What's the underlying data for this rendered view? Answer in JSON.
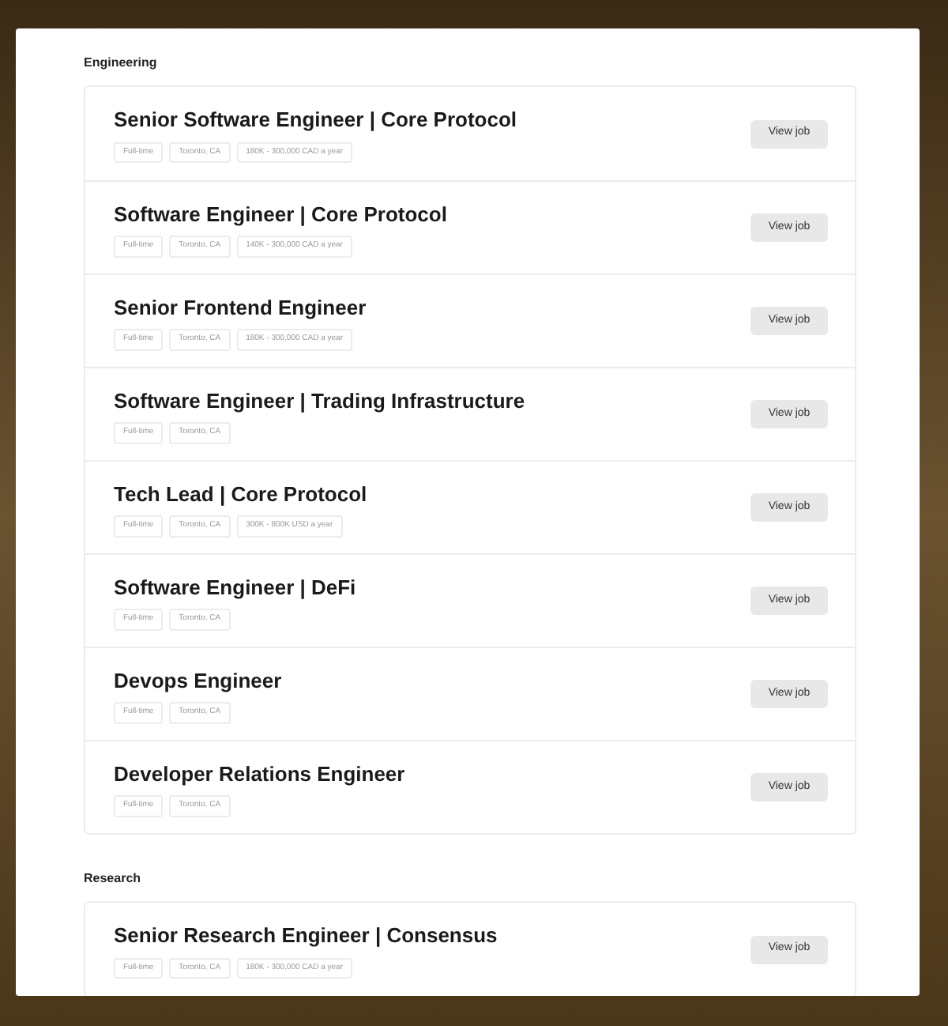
{
  "sections": [
    {
      "heading": "Engineering",
      "jobs": [
        {
          "title": "Senior Software Engineer | Core Protocol",
          "tags": [
            "Full-time",
            "Toronto, CA",
            "180K - 300,000 CAD a year"
          ],
          "button": "View job"
        },
        {
          "title": "Software Engineer | Core Protocol",
          "tags": [
            "Full-time",
            "Toronto, CA",
            "140K - 300,000 CAD a year"
          ],
          "button": "View job"
        },
        {
          "title": "Senior Frontend Engineer",
          "tags": [
            "Full-time",
            "Toronto, CA",
            "180K - 300,000 CAD a year"
          ],
          "button": "View job"
        },
        {
          "title": "Software Engineer | Trading Infrastructure",
          "tags": [
            "Full-time",
            "Toronto, CA"
          ],
          "button": "View job"
        },
        {
          "title": "Tech Lead | Core Protocol",
          "tags": [
            "Full-time",
            "Toronto, CA",
            "300K - 800K USD a year"
          ],
          "button": "View job"
        },
        {
          "title": "Software Engineer | DeFi",
          "tags": [
            "Full-time",
            "Toronto, CA"
          ],
          "button": "View job"
        },
        {
          "title": "Devops Engineer",
          "tags": [
            "Full-time",
            "Toronto, CA"
          ],
          "button": "View job"
        },
        {
          "title": "Developer Relations Engineer",
          "tags": [
            "Full-time",
            "Toronto, CA"
          ],
          "button": "View job"
        }
      ]
    },
    {
      "heading": "Research",
      "jobs": [
        {
          "title": "Senior Research Engineer | Consensus",
          "tags": [
            "Full-time",
            "Toronto, CA",
            "180K - 300,000 CAD a year"
          ],
          "button": "View job"
        }
      ]
    }
  ]
}
